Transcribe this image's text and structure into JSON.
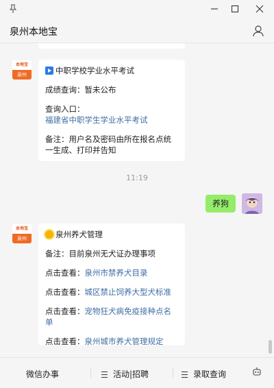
{
  "window": {
    "title": "泉州本地宝"
  },
  "account_avatar": {
    "top_text": "本地宝",
    "bottom_text": "泉州"
  },
  "messages": {
    "exam": {
      "title": "中职学校学业水平考试",
      "line1": "成绩查询：暂未公布",
      "line2": "查询入口：",
      "link": "福建省中职学生学业水平考试",
      "note": "备注：用户名及密码由所在报名点统一生成、打印并告知"
    },
    "time": "11:19",
    "user_message": "养狗",
    "dog": {
      "title": "泉州养犬管理",
      "note": "备注：目前泉州无犬证办理事项",
      "items": [
        {
          "label": "点击查看：",
          "link": "泉州市禁养犬目录"
        },
        {
          "label": "点击查看：",
          "link": "城区禁止饲养大型犬标准"
        },
        {
          "label": "点击查看：",
          "link": "宠物狂犬病免疫接种点名单"
        },
        {
          "label": "点击查看：",
          "link": "泉州城市养犬管理规定"
        }
      ]
    }
  },
  "menu": {
    "items": [
      "微信办事",
      "活动|招聘",
      "录取查询"
    ]
  },
  "icons": [
    "pin-icon",
    "minimize-icon",
    "maximize-icon",
    "close-icon",
    "person-icon",
    "play-icon",
    "sun-icon",
    "menu-list-icon",
    "robot-icon"
  ],
  "colors": {
    "link": "#3e6ea5",
    "user_bubble": "#95ec69",
    "brand": "#f06a25"
  }
}
